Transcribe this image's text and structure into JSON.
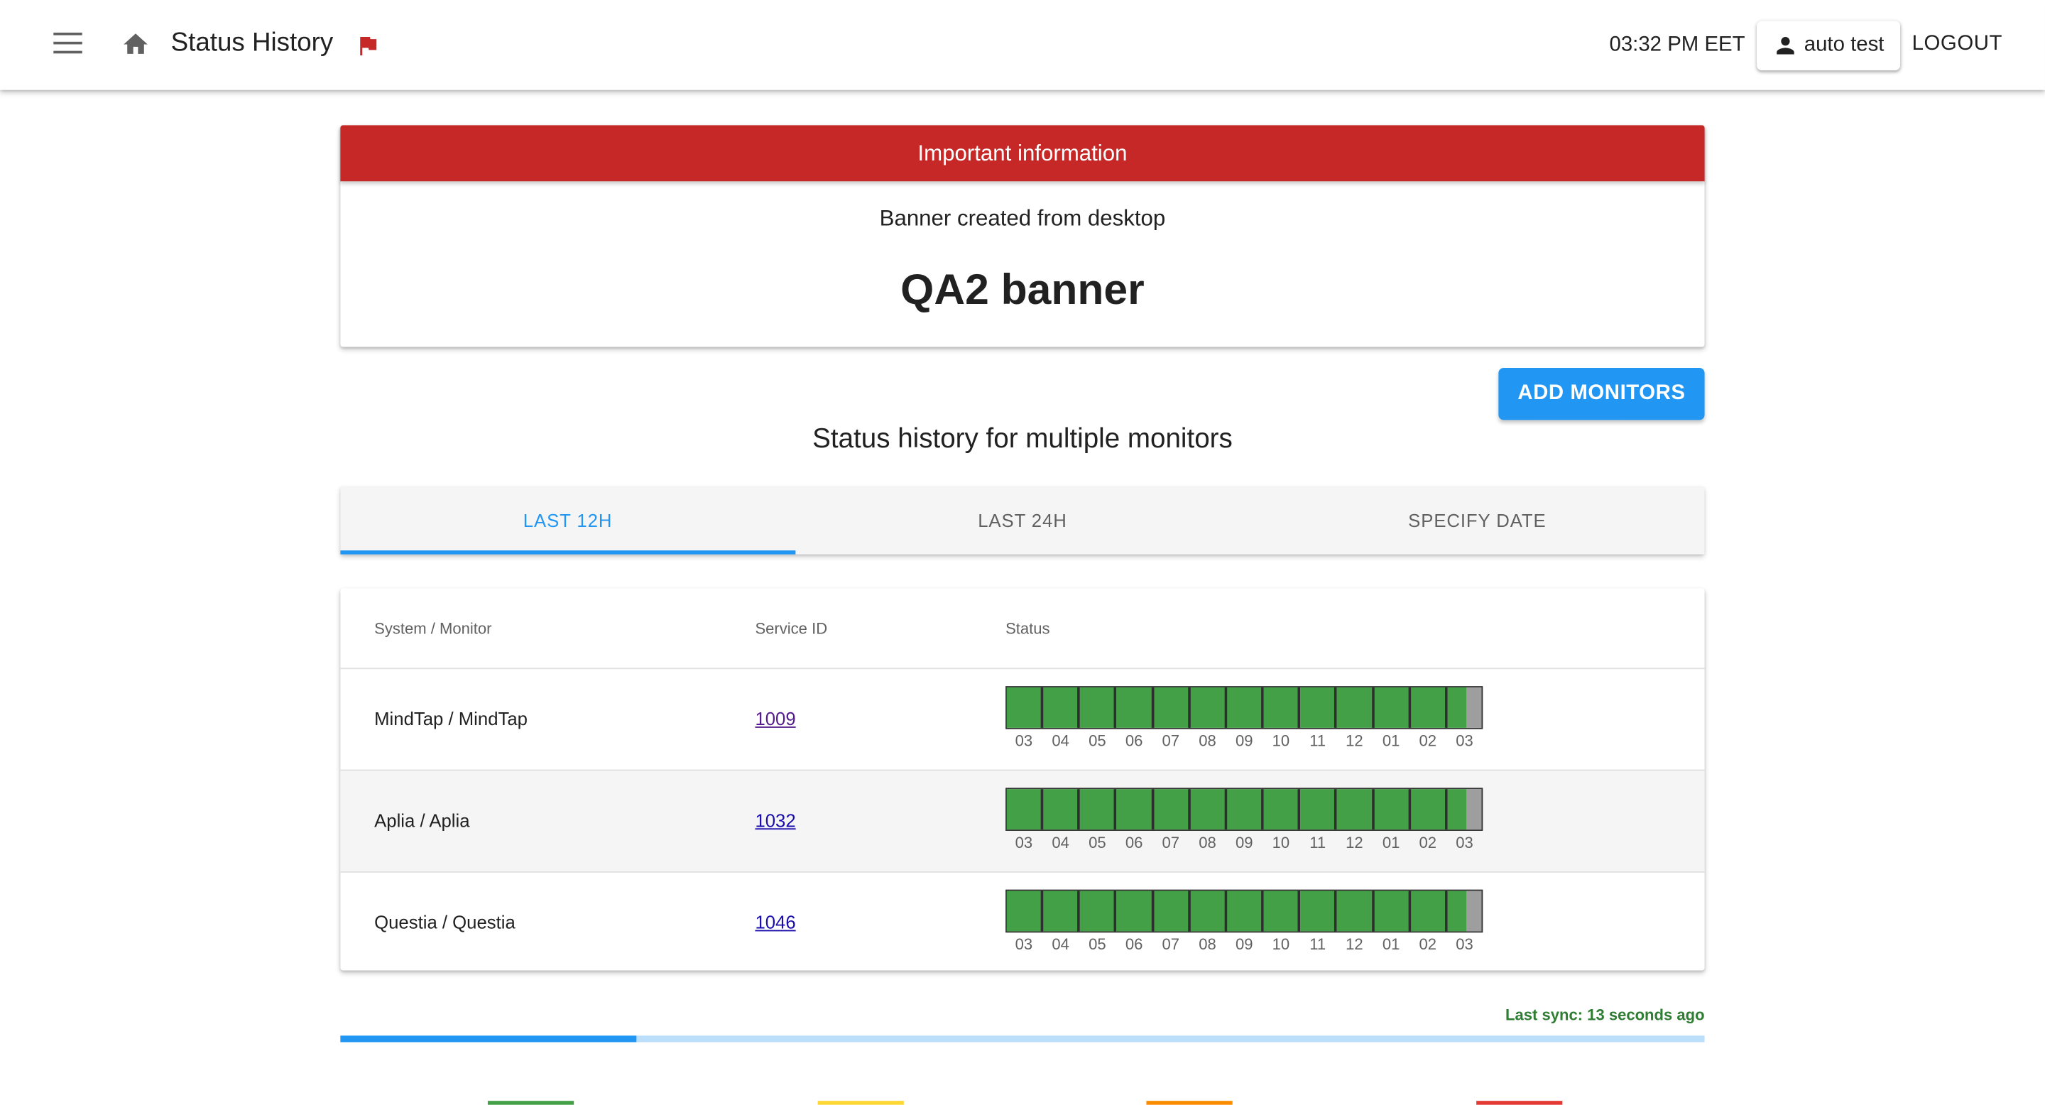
{
  "header": {
    "title": "Status History",
    "time": "03:32 PM EET",
    "user": "auto test",
    "logout": "LOGOUT"
  },
  "banner": {
    "heading": "Important information",
    "subtitle": "Banner created from desktop",
    "message": "QA2 banner",
    "color": "#c62828"
  },
  "actions": {
    "add_monitors": "ADD MONITORS"
  },
  "section_title": "Status history for multiple monitors",
  "tabs": [
    {
      "label": "LAST 12H",
      "active": true
    },
    {
      "label": "LAST 24H",
      "active": false
    },
    {
      "label": "SPECIFY DATE",
      "active": false
    }
  ],
  "table": {
    "headers": {
      "system": "System / Monitor",
      "service": "Service ID",
      "status": "Status"
    },
    "hours": [
      "03",
      "04",
      "05",
      "06",
      "07",
      "08",
      "09",
      "10",
      "11",
      "12",
      "01",
      "02",
      "03"
    ],
    "rows": [
      {
        "name": "MindTap / MindTap",
        "service_id": "1009",
        "visited": true
      },
      {
        "name": "Aplia / Aplia",
        "service_id": "1032",
        "visited": false
      },
      {
        "name": "Questia / Questia",
        "service_id": "1046",
        "visited": false
      }
    ],
    "status_colors": {
      "up": "#43a047",
      "no_data": "#9e9e9e"
    }
  },
  "sync": {
    "text": "Last sync: 13 seconds ago",
    "progress": 0.217
  },
  "legend_colors": [
    "#43a047",
    "#fdd835",
    "#fb8c00",
    "#e53935"
  ],
  "icons": [
    "menu-icon",
    "home-icon",
    "flag-icon",
    "person-icon"
  ]
}
